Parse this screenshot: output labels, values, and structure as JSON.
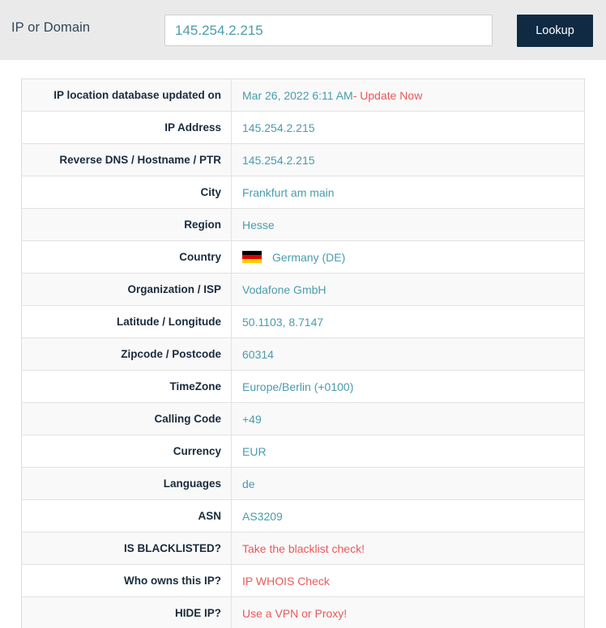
{
  "search": {
    "label": "IP or Domain",
    "value": "145.254.2.215",
    "placeholder": "IP or Domain",
    "button_label": "Lookup"
  },
  "colors": {
    "accent_teal": "#4a9cab",
    "link_red": "#e8595b",
    "button_bg": "#102a43",
    "bar_bg": "#eaeaea"
  },
  "table": {
    "rows": [
      {
        "label": "IP location database updated on",
        "value": "Mar 26, 2022 6:11 AM",
        "value_suffix": " - Update Now",
        "value_style": "teal",
        "suffix_style": "red"
      },
      {
        "label": "IP Address",
        "value": "145.254.2.215",
        "value_style": "teal"
      },
      {
        "label": "Reverse DNS / Hostname / PTR",
        "value": "145.254.2.215",
        "value_style": "teal"
      },
      {
        "label": "City",
        "value": "Frankfurt am main",
        "value_style": "teal"
      },
      {
        "label": "Region",
        "value": "Hesse",
        "value_style": "teal"
      },
      {
        "label": "Country",
        "value": "Germany (DE)",
        "value_style": "teal",
        "flag": "germany-flag"
      },
      {
        "label": "Organization / ISP",
        "value": "Vodafone GmbH",
        "value_style": "teal"
      },
      {
        "label": "Latitude / Longitude",
        "value": "50.1103, 8.7147",
        "value_style": "teal"
      },
      {
        "label": "Zipcode / Postcode",
        "value": "60314",
        "value_style": "teal"
      },
      {
        "label": "TimeZone",
        "value": "Europe/Berlin (+0100)",
        "value_style": "teal"
      },
      {
        "label": "Calling Code",
        "value": "+49",
        "value_style": "teal"
      },
      {
        "label": "Currency",
        "value": "EUR",
        "value_style": "teal"
      },
      {
        "label": "Languages",
        "value": "de",
        "value_style": "teal"
      },
      {
        "label": "ASN",
        "value": "AS3209",
        "value_style": "teal"
      },
      {
        "label": "IS BLACKLISTED?",
        "value": "Take the blacklist check!",
        "value_style": "red"
      },
      {
        "label": "Who owns this IP?",
        "value": "IP WHOIS Check",
        "value_style": "red"
      },
      {
        "label": "HIDE IP?",
        "value": "Use a VPN or Proxy!",
        "value_style": "red"
      }
    ]
  }
}
